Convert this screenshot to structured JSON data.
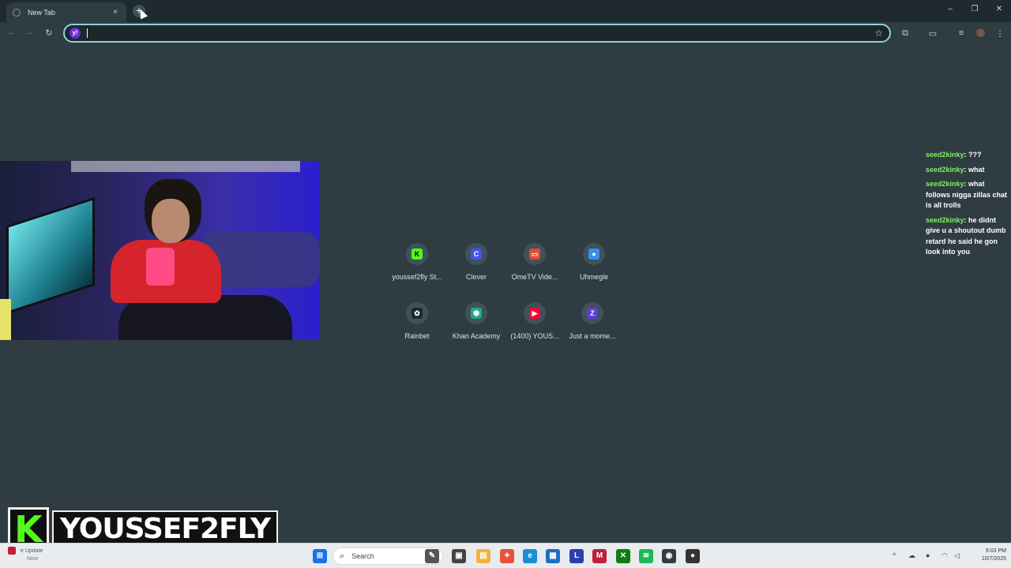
{
  "browser": {
    "tab": {
      "title": "New Tab",
      "close_glyph": "×"
    },
    "new_tab_glyph": "+",
    "omnibox": {
      "value": "",
      "search_engine_icon": "yahoo-icon",
      "search_engine_glyph": "y!"
    },
    "window_controls": {
      "minimize": "–",
      "maximize": "❐",
      "close": "✕"
    }
  },
  "webcam_overlay": {
    "description_icon": "webcam-feed"
  },
  "chat": [
    {
      "user": "seed2kinky",
      "text": "???"
    },
    {
      "user": "seed2kinky",
      "text": "what"
    },
    {
      "user": "seed2kinky",
      "text": "what follows nigga zillas chat is all trolls"
    },
    {
      "user": "seed2kinky",
      "text": "he didnt give u a shoutout dumb retard he said he gon look into you"
    }
  ],
  "shortcuts": [
    {
      "label": "youssef2fly St...",
      "glyph": "K",
      "color": "#53fc18",
      "text_color": "#000"
    },
    {
      "label": "Clever",
      "glyph": "C",
      "color": "#4452f5",
      "text_color": "#fff"
    },
    {
      "label": "OmeTV Vide...",
      "glyph": "▭",
      "color": "#e04a3a",
      "text_color": "#fff"
    },
    {
      "label": "Uhmegle",
      "glyph": "●",
      "color": "#3a8df0",
      "text_color": "#fff"
    },
    {
      "label": "Rainbet",
      "glyph": "✿",
      "color": "#1e2a30",
      "text_color": "#fff"
    },
    {
      "label": "Khan Academy",
      "glyph": "⬢",
      "color": "#1fab89",
      "text_color": "#fff"
    },
    {
      "label": "(1400) YOUS...",
      "glyph": "▶",
      "color": "#ff0033",
      "text_color": "#fff"
    },
    {
      "label": "Just a mome...",
      "glyph": "Z",
      "color": "#5b3fd6",
      "text_color": "#fff"
    }
  ],
  "streamer_badge": {
    "logo_letter": "K",
    "name": "YOUSSEF2FLY"
  },
  "taskbar": {
    "notification": {
      "title": "e Update",
      "subtitle": "Now"
    },
    "search_placeholder": "Search",
    "search_glyph": "⌕",
    "clock": {
      "time": "9:03 PM",
      "date": "10/7/2025"
    },
    "tray_caret": "^"
  }
}
